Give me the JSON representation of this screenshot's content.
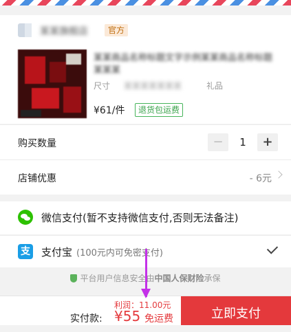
{
  "shop": {
    "name": "某某旗舰店",
    "badge": "官方"
  },
  "product": {
    "title": "某某商品名称标题文字示例某某商品名称标题 某某某",
    "spec_label": "尺寸",
    "spec_value": "某某某某某某某",
    "spec_tail": "礼品",
    "price": "¥61/件",
    "return_tag": "退货包运费"
  },
  "quantity": {
    "label": "购买数量",
    "minus": "−",
    "value": "1",
    "plus": "+"
  },
  "discount": {
    "label": "店铺优惠",
    "value": "- 6元"
  },
  "payment": {
    "wechat_label": "微信支付(暂不支持微信支付,否则无法备注)",
    "alipay_label": "支付宝",
    "alipay_sub": "(100元内可免密支付)"
  },
  "secure": {
    "prefix": "平台用户信息安全由",
    "insurer": "中国人保财险",
    "suffix": "承保"
  },
  "bottom": {
    "profit": "利润：11.00元",
    "total_label": "实付款:",
    "total_value": "¥55",
    "shipping": "免运费",
    "pay_button": "立即支付"
  },
  "colors": {
    "accent": "#e4393c",
    "wechat": "#2dc100",
    "alipay": "#1a9ee6",
    "annotation_arrow": "#c431e8"
  }
}
